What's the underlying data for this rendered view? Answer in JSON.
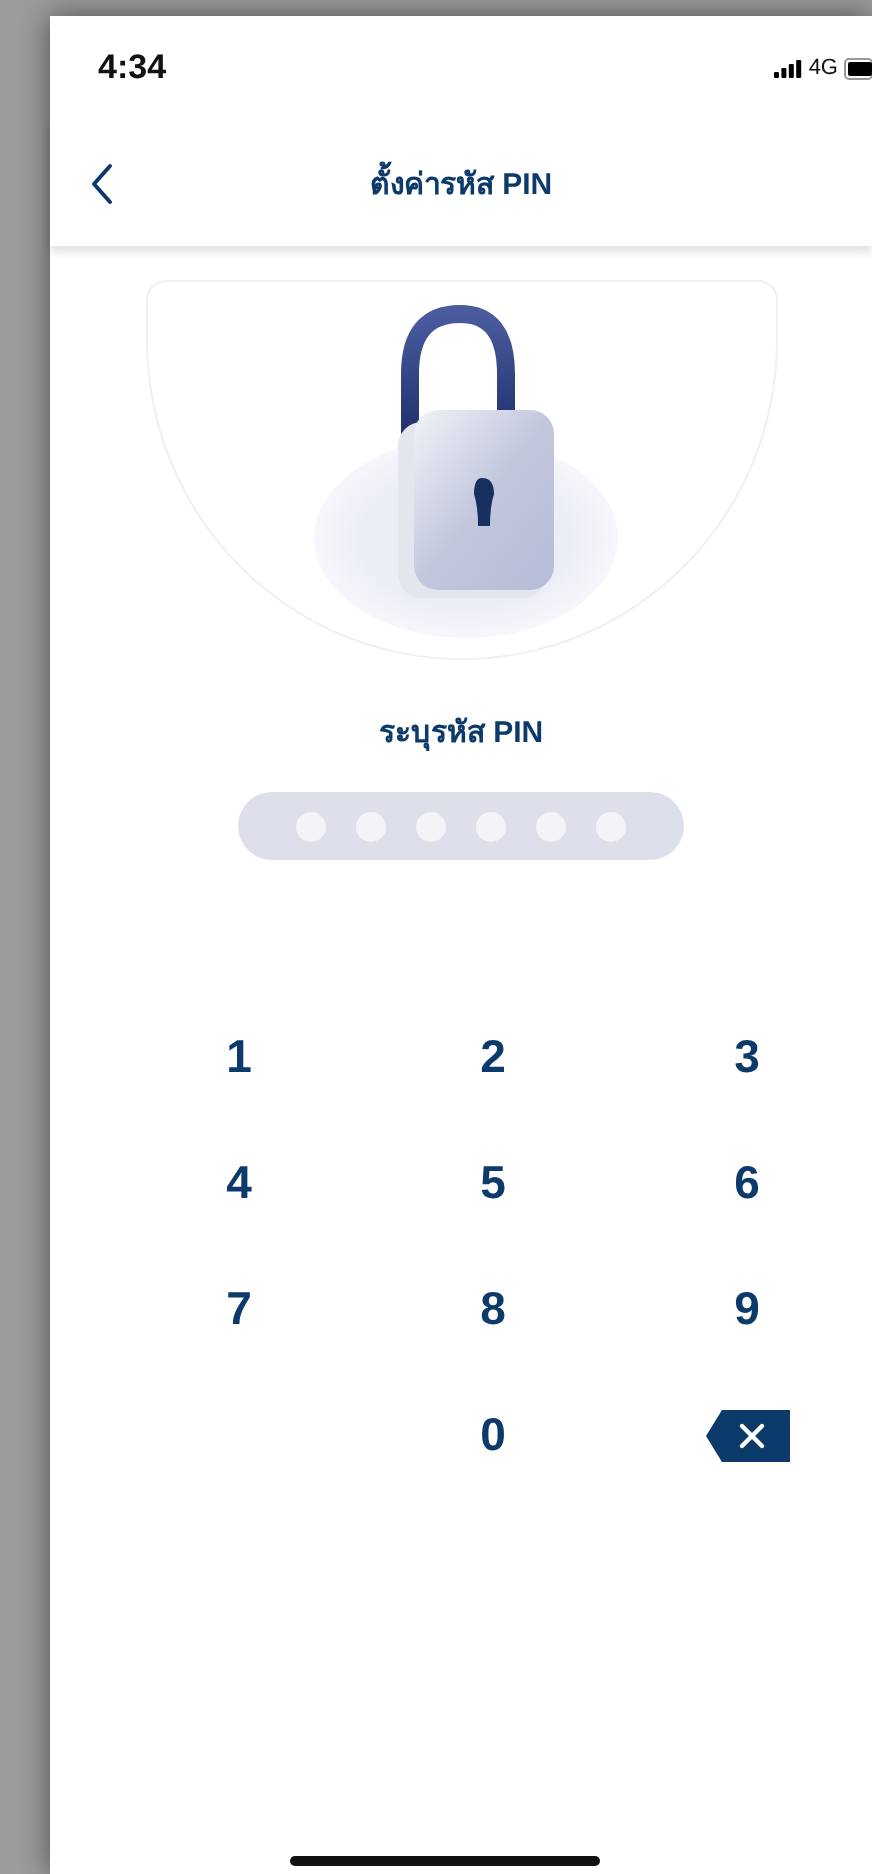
{
  "status_bar": {
    "time": "4:34",
    "network": "4G"
  },
  "nav": {
    "title": "ตั้งค่ารหัส PIN"
  },
  "prompt": "ระบุรหัส PIN",
  "pin_dots": [
    {
      "filled": false
    },
    {
      "filled": false
    },
    {
      "filled": false
    },
    {
      "filled": false
    },
    {
      "filled": false
    },
    {
      "filled": false
    }
  ],
  "keypad": [
    {
      "kind": "digit",
      "label": "1"
    },
    {
      "kind": "digit",
      "label": "2"
    },
    {
      "kind": "digit",
      "label": "3"
    },
    {
      "kind": "digit",
      "label": "4"
    },
    {
      "kind": "digit",
      "label": "5"
    },
    {
      "kind": "digit",
      "label": "6"
    },
    {
      "kind": "digit",
      "label": "7"
    },
    {
      "kind": "digit",
      "label": "8"
    },
    {
      "kind": "digit",
      "label": "9"
    },
    {
      "kind": "blank"
    },
    {
      "kind": "digit",
      "label": "0"
    },
    {
      "kind": "backspace"
    }
  ]
}
